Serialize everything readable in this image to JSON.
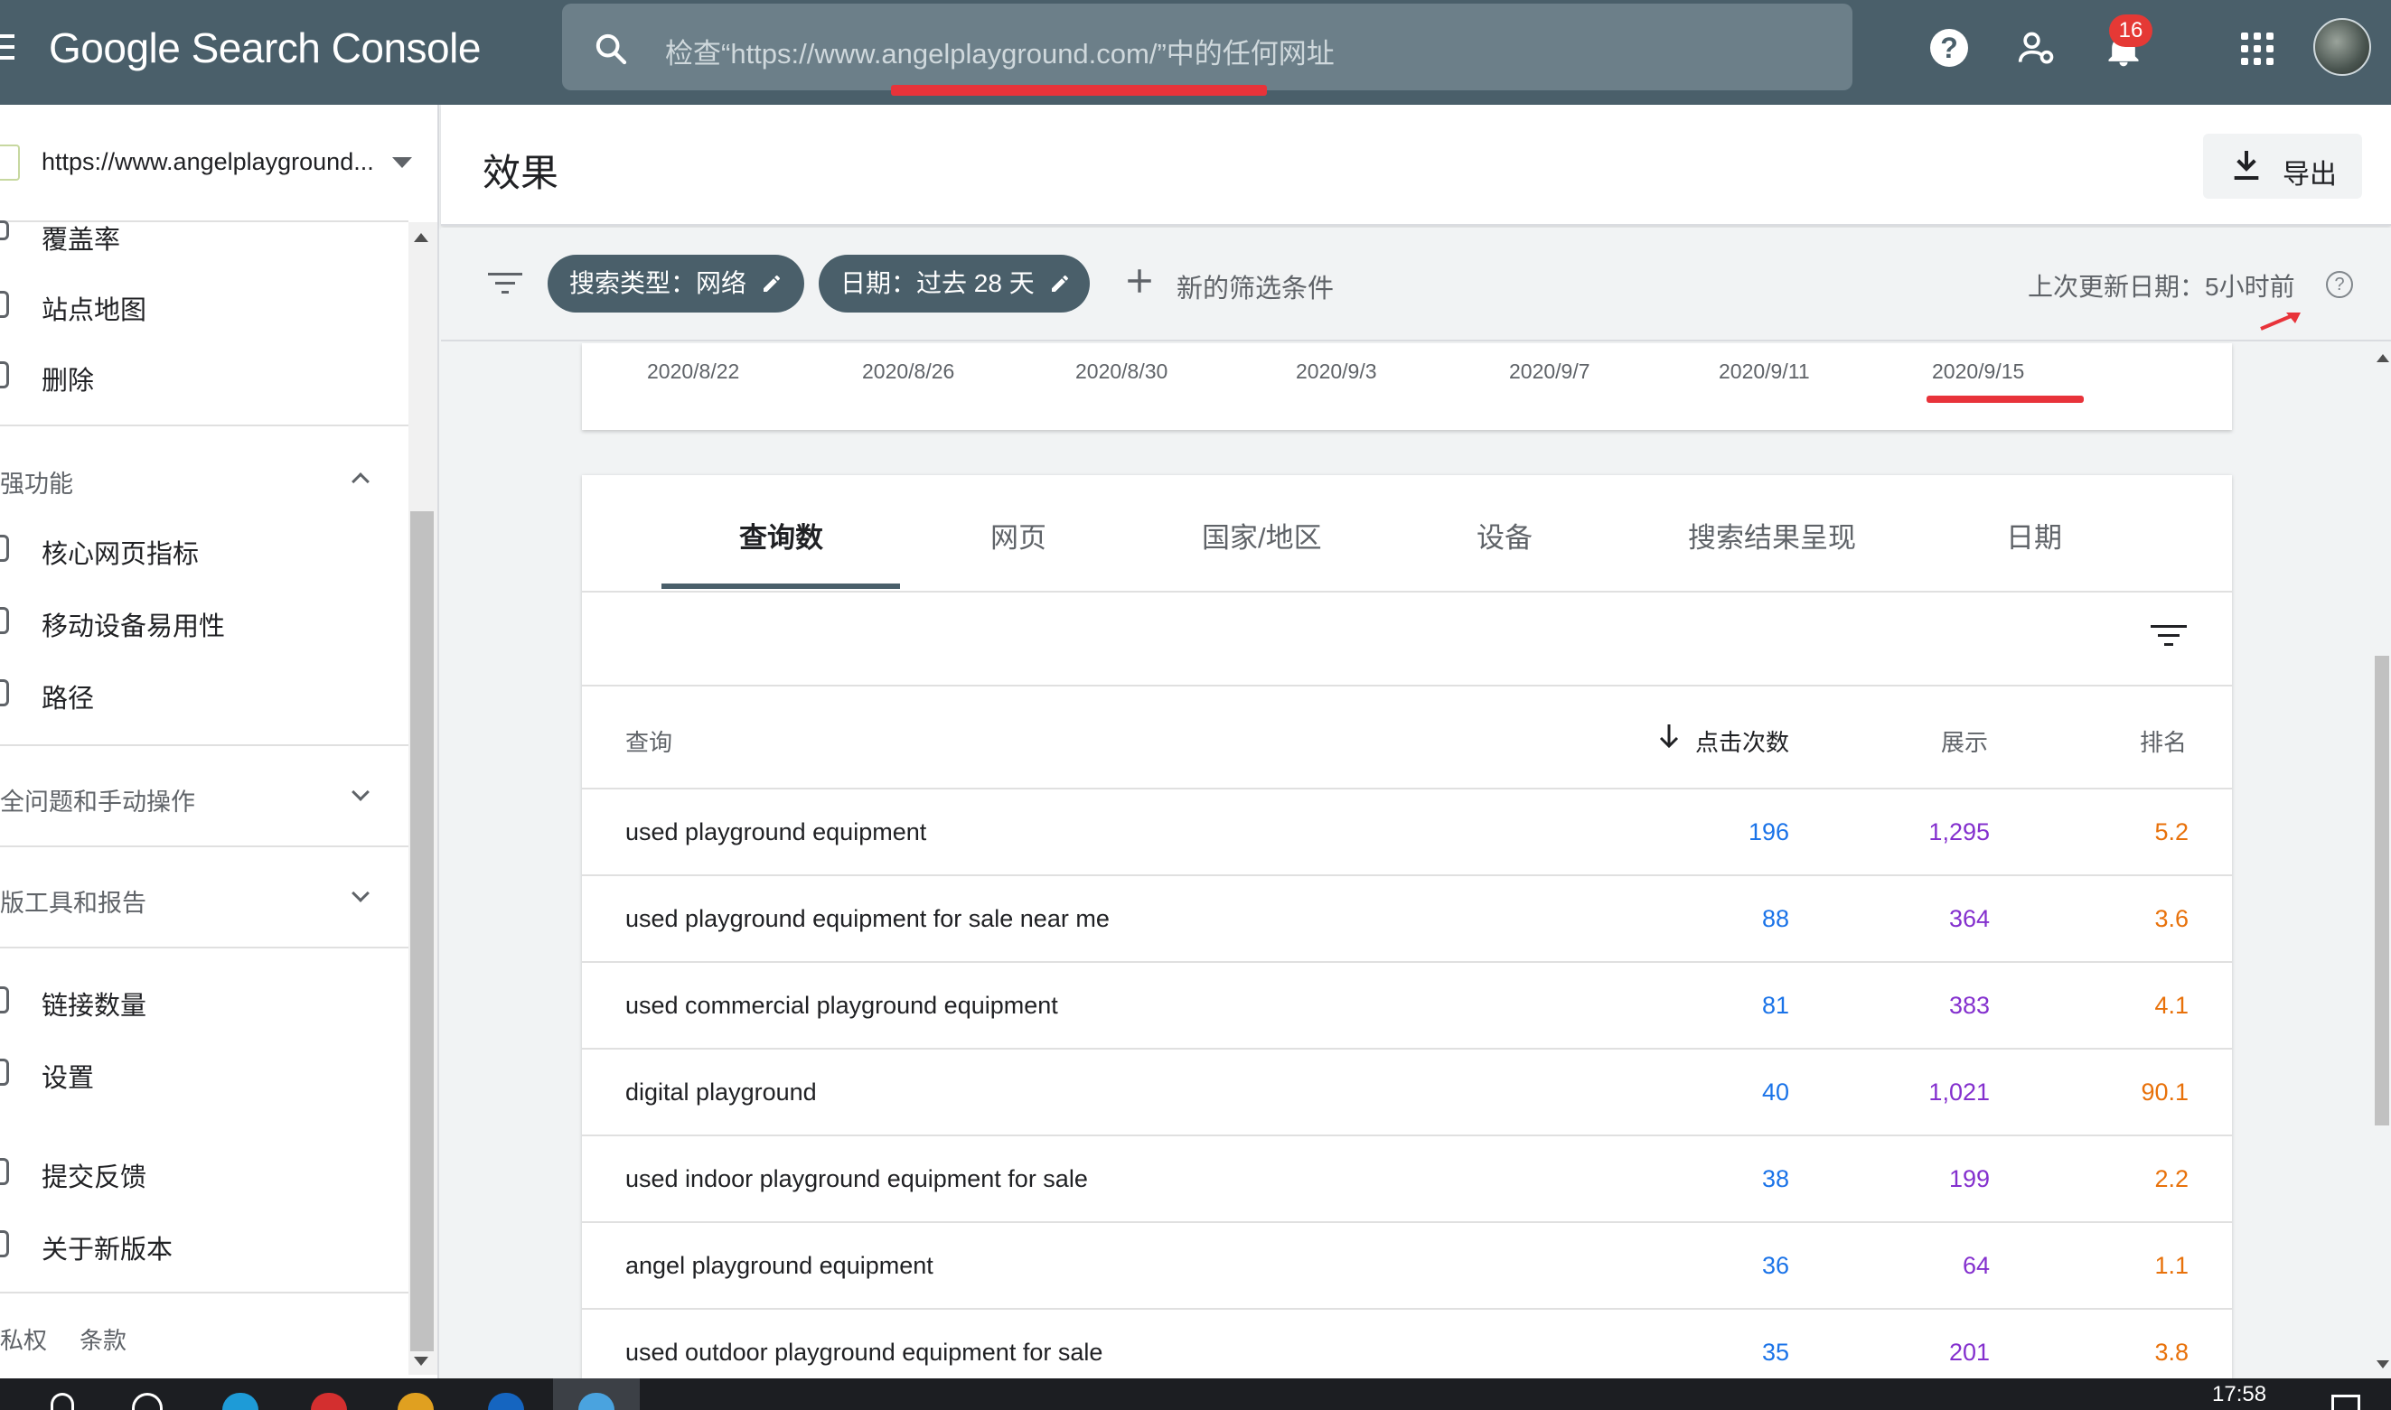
{
  "app": {
    "title": "Google Search Console"
  },
  "search": {
    "placeholder": "检查“https://www.angelplayground.com/”中的任何网址"
  },
  "header_icons": {
    "notification_count": "16",
    "help_glyph": "?"
  },
  "colors": {
    "topbar": "#4a5f6a",
    "clicks": "#1a73e8",
    "impressions": "#8430ce",
    "position": "#e8710a",
    "annotation_red": "#e8333a"
  },
  "sidebar": {
    "property": "https://www.angelplayground...",
    "items_top": [
      {
        "label": "覆盖率",
        "icon": "coverage-icon"
      },
      {
        "label": "站点地图",
        "icon": "sitemap-icon"
      },
      {
        "label": "删除",
        "icon": "removals-icon"
      }
    ],
    "section_enhancements": "强功能",
    "items_enhancements": [
      {
        "label": "核心网页指标",
        "icon": "core-vitals-icon"
      },
      {
        "label": "移动设备易用性",
        "icon": "mobile-icon"
      },
      {
        "label": "路径",
        "icon": "breadcrumb-icon"
      }
    ],
    "section_security": "全问题和手动操作",
    "section_legacy": "版工具和报告",
    "items_bottom": [
      {
        "label": "链接数量",
        "icon": "links-icon"
      },
      {
        "label": "设置",
        "icon": "settings-icon"
      }
    ],
    "items_footer": [
      {
        "label": "提交反馈",
        "icon": "feedback-icon"
      },
      {
        "label": "关于新版本",
        "icon": "info-icon"
      }
    ],
    "privacy": "私权",
    "terms": "条款"
  },
  "page": {
    "title": "效果",
    "export_label": "导出"
  },
  "filters": {
    "chip_search_type": "搜索类型：网络",
    "chip_date": "日期：过去 28 天",
    "add_filter": "新的筛选条件",
    "last_update": "上次更新日期：5小时前"
  },
  "chart_axis_dates": [
    "2020/8/22",
    "2020/8/26",
    "2020/8/30",
    "2020/9/3",
    "2020/9/7",
    "2020/9/11",
    "2020/9/15"
  ],
  "tabs": [
    {
      "label": "查询数",
      "active": true
    },
    {
      "label": "网页",
      "active": false
    },
    {
      "label": "国家/地区",
      "active": false
    },
    {
      "label": "设备",
      "active": false
    },
    {
      "label": "搜索结果呈现",
      "active": false
    },
    {
      "label": "日期",
      "active": false
    }
  ],
  "table": {
    "columns": {
      "query": "查询",
      "clicks": "点击次数",
      "impressions": "展示",
      "position": "排名"
    },
    "rows": [
      {
        "query": "used playground equipment",
        "clicks": "196",
        "impressions": "1,295",
        "position": "5.2"
      },
      {
        "query": "used playground equipment for sale near me",
        "clicks": "88",
        "impressions": "364",
        "position": "3.6"
      },
      {
        "query": "used commercial playground equipment",
        "clicks": "81",
        "impressions": "383",
        "position": "4.1"
      },
      {
        "query": "digital playground",
        "clicks": "40",
        "impressions": "1,021",
        "position": "90.1"
      },
      {
        "query": "used indoor playground equipment for sale",
        "clicks": "38",
        "impressions": "199",
        "position": "2.2"
      },
      {
        "query": "angel playground equipment",
        "clicks": "36",
        "impressions": "64",
        "position": "1.1"
      },
      {
        "query": "used outdoor playground equipment for sale",
        "clicks": "35",
        "impressions": "201",
        "position": "3.8"
      }
    ]
  },
  "taskbar": {
    "clock": "17:58"
  }
}
